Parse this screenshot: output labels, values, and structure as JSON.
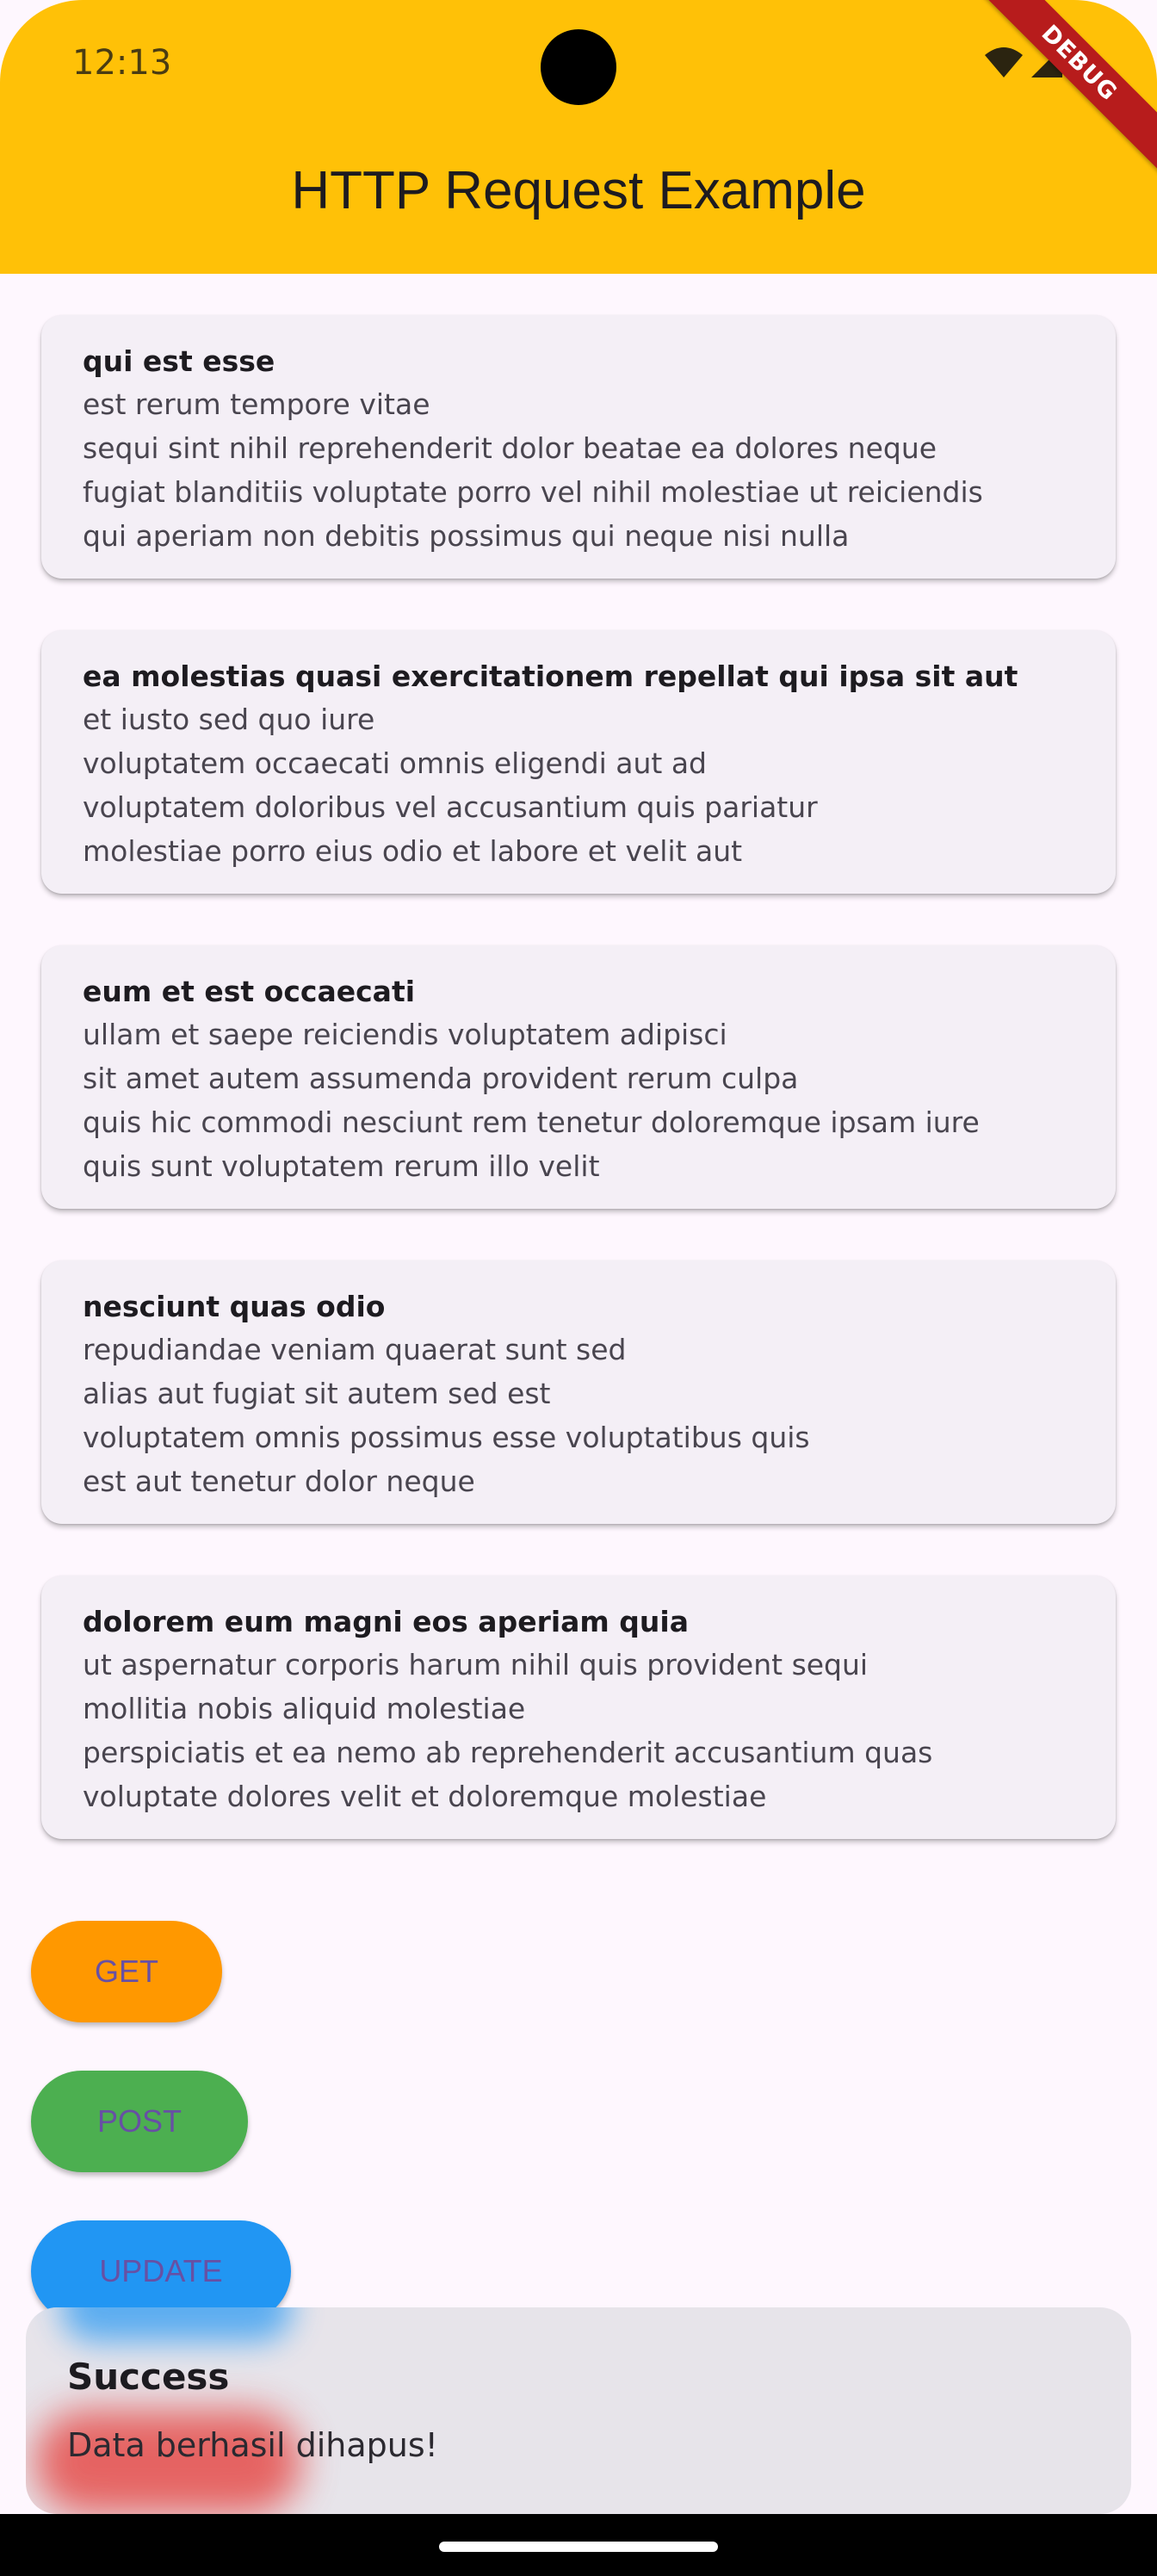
{
  "status_bar": {
    "time": "12:13",
    "debug_label": "DEBUG"
  },
  "app_bar": {
    "title": "HTTP Request Example",
    "color": "#ffc107"
  },
  "posts": [
    {
      "title": "qui est esse",
      "body": "est rerum tempore vitae\nsequi sint nihil reprehenderit dolor beatae ea dolores neque\nfugiat blanditiis voluptate porro vel nihil molestiae ut reiciendis\nqui aperiam non debitis possimus qui neque nisi nulla"
    },
    {
      "title": "ea molestias quasi exercitationem repellat qui ipsa sit aut",
      "body": "et iusto sed quo iure\nvoluptatem occaecati omnis eligendi aut ad\nvoluptatem doloribus vel accusantium quis pariatur\nmolestiae porro eius odio et labore et velit aut"
    },
    {
      "title": "eum et est occaecati",
      "body": "ullam et saepe reiciendis voluptatem adipisci\nsit amet autem assumenda provident rerum culpa\nquis hic commodi nesciunt rem tenetur doloremque ipsam iure\nquis sunt voluptatem rerum illo velit"
    },
    {
      "title": "nesciunt quas odio",
      "body": "repudiandae veniam quaerat sunt sed\nalias aut fugiat sit autem sed est\nvoluptatem omnis possimus esse voluptatibus quis\nest aut tenetur dolor neque"
    },
    {
      "title": "dolorem eum magni eos aperiam quia",
      "body": "ut aspernatur corporis harum nihil quis provident sequi\nmollitia nobis aliquid molestiae\nperspiciatis et ea nemo ab reprehenderit accusantium quas\nvoluptate dolores velit et doloremque molestiae"
    }
  ],
  "buttons": {
    "get": {
      "label": "GET",
      "color": "#ff9800"
    },
    "post": {
      "label": "POST",
      "color": "#4caf50"
    },
    "update": {
      "label": "UPDATE",
      "color": "#2196f3"
    }
  },
  "snackbar": {
    "title": "Success",
    "message": "Data berhasil dihapus!"
  }
}
